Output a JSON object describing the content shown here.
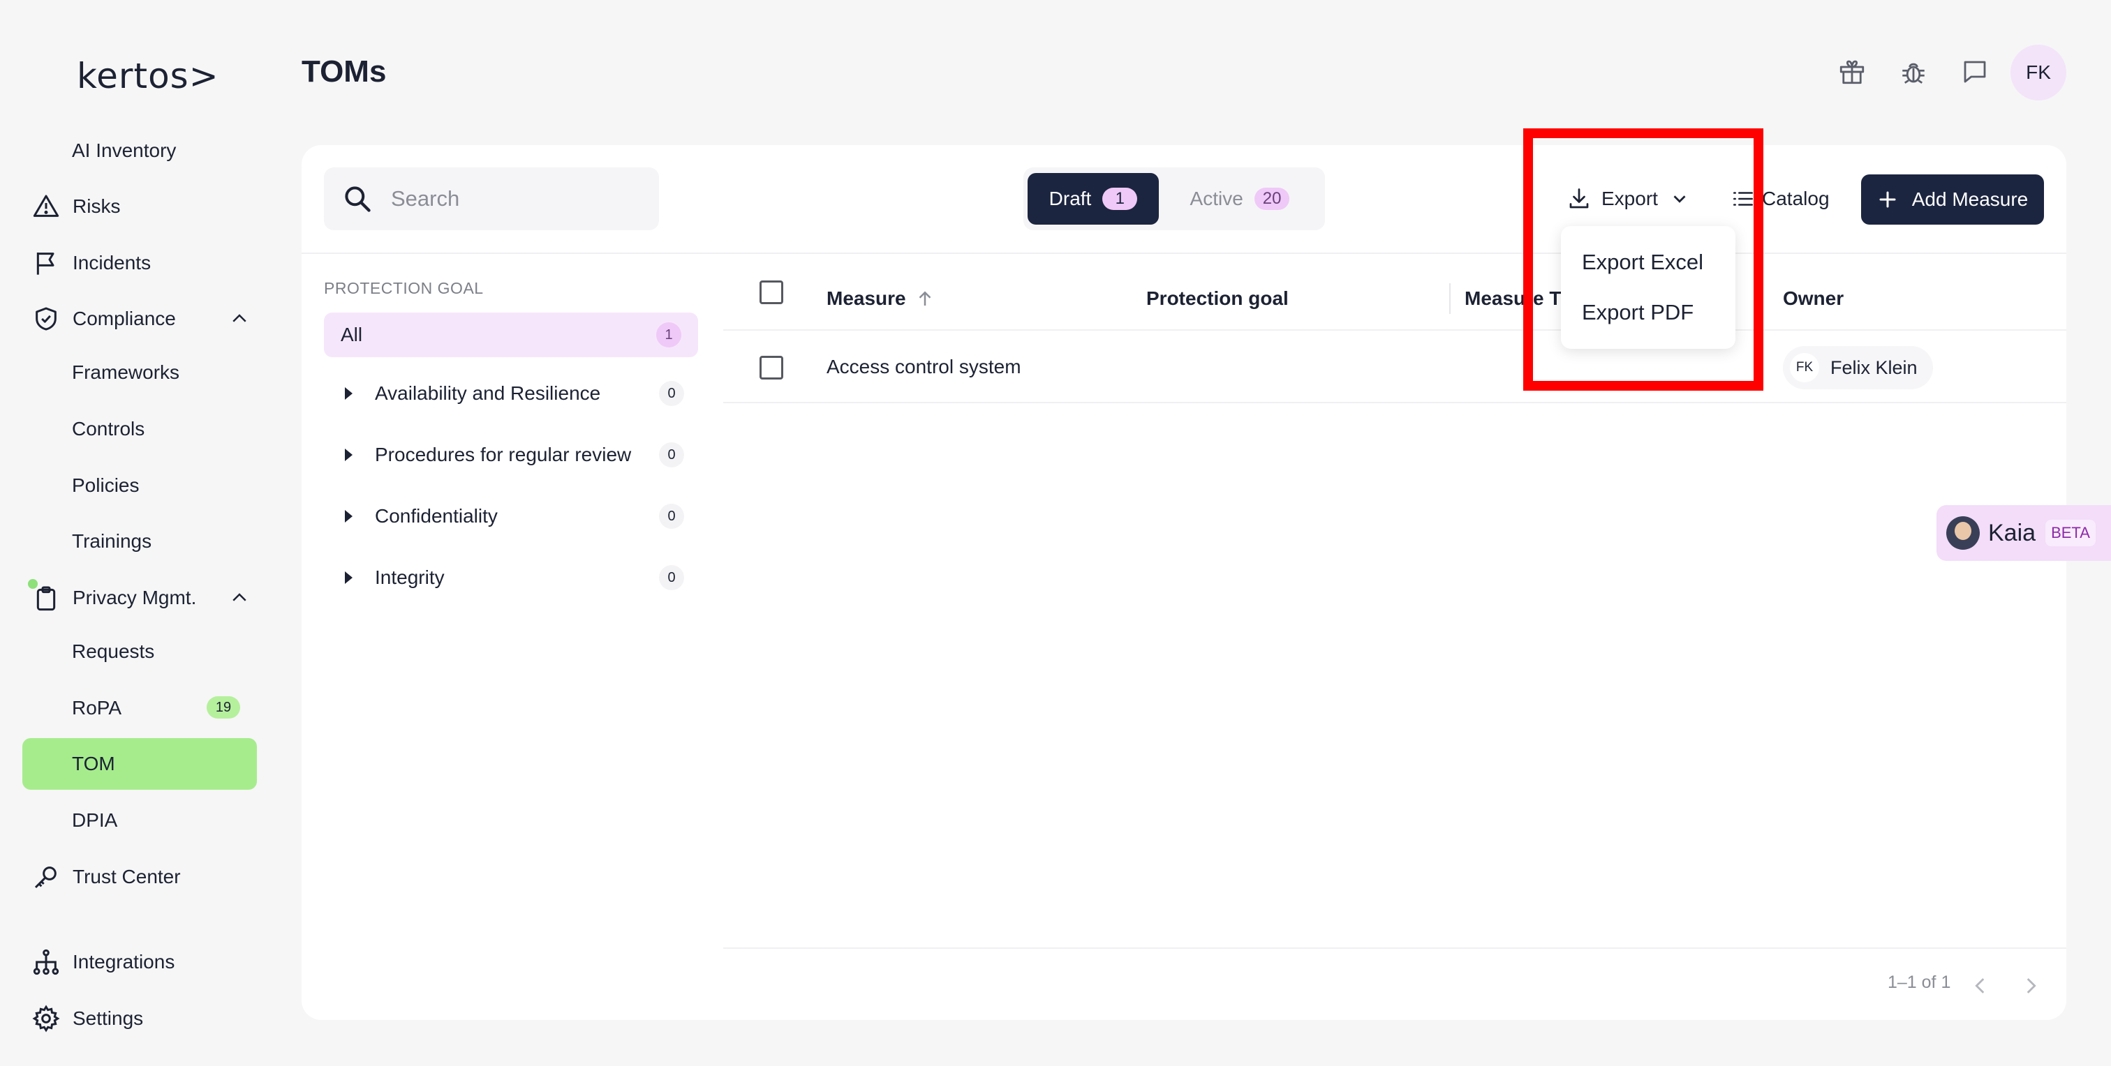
{
  "app": {
    "logo_text": "kertos>",
    "page_title": "TOMs",
    "avatar_initials": "FK"
  },
  "sidebar": {
    "items": [
      {
        "label": "AI Inventory"
      },
      {
        "label": "Risks",
        "icon": "warning-icon"
      },
      {
        "label": "Incidents",
        "icon": "flag-icon"
      },
      {
        "label": "Compliance",
        "icon": "shield-check-icon"
      },
      {
        "label": "Frameworks"
      },
      {
        "label": "Controls"
      },
      {
        "label": "Policies"
      },
      {
        "label": "Trainings"
      },
      {
        "label": "Privacy Mgmt.",
        "icon": "clipboard-icon"
      },
      {
        "label": "Requests"
      },
      {
        "label": "RoPA",
        "badge": "19"
      },
      {
        "label": "TOM"
      },
      {
        "label": "DPIA"
      },
      {
        "label": "Trust Center",
        "icon": "key-icon"
      },
      {
        "label": "Integrations",
        "icon": "hierarchy-icon"
      },
      {
        "label": "Settings",
        "icon": "gear-icon"
      }
    ],
    "active": "TOM"
  },
  "toolbar": {
    "search_placeholder": "Search",
    "tabs": [
      {
        "label": "Draft",
        "count": "1"
      },
      {
        "label": "Active",
        "count": "20"
      }
    ],
    "export_label": "Export",
    "catalog_label": "Catalog",
    "add_label": "Add Measure"
  },
  "export_menu": {
    "items": [
      "Export Excel",
      "Export PDF"
    ]
  },
  "filters": {
    "title": "PROTECTION GOAL",
    "all": {
      "label": "All",
      "count": "1"
    },
    "groups": [
      {
        "label": "Availability and Resilience",
        "count": "0"
      },
      {
        "label": "Procedures for regular review",
        "count": "0"
      },
      {
        "label": "Confidentiality",
        "count": "0"
      },
      {
        "label": "Integrity",
        "count": "0"
      }
    ]
  },
  "table": {
    "columns": [
      "Measure",
      "Protection goal",
      "Measure T",
      "Owner"
    ],
    "rows": [
      {
        "measure": "Access control system",
        "protection_goal": "",
        "measure_type": "",
        "owner": "Felix Klein",
        "owner_initials": "FK"
      }
    ],
    "pagination": "1–1 of 1"
  },
  "assistant": {
    "name": "Kaia",
    "badge": "BETA"
  },
  "colors": {
    "primary_dark": "#1c2540",
    "active_nav": "#a6ec8d",
    "accent_pink": "#efc9f7",
    "highlight": "#ff0000"
  }
}
